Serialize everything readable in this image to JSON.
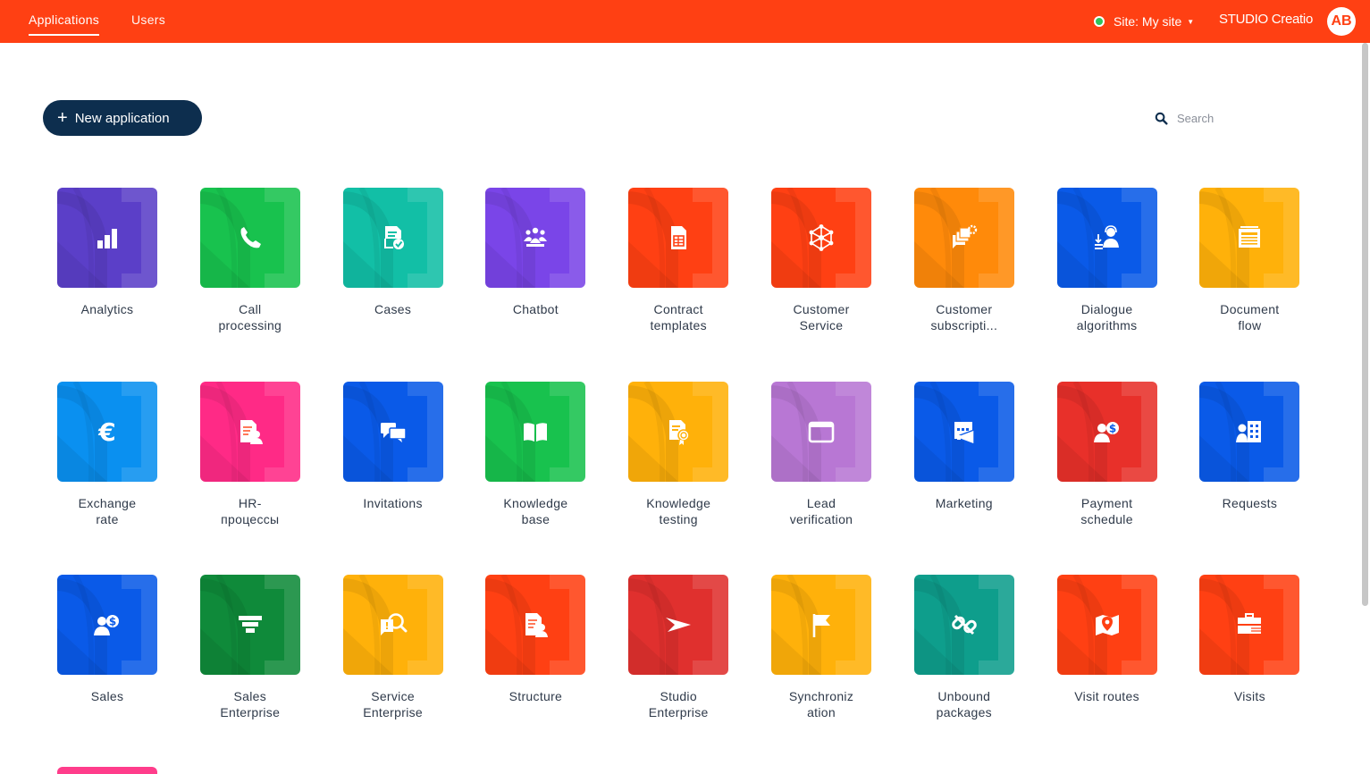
{
  "topbar": {
    "tabs": [
      {
        "label": "Applications",
        "active": true
      },
      {
        "label": "Users",
        "active": false
      }
    ],
    "site_label": "Site: My site",
    "brand": "STUDIO Creatio",
    "avatar_initials": "AB",
    "status_color": "#2fc35b",
    "accent_color": "#ff4013"
  },
  "toolbar": {
    "new_app_label": "New application",
    "search_placeholder": "Search"
  },
  "apps": [
    {
      "label": "Analytics",
      "color": "#5b3fc8",
      "icon": "bar-chart-icon"
    },
    {
      "label": "Call\nprocessing",
      "color": "#18c24e",
      "icon": "phone-icon"
    },
    {
      "label": "Cases",
      "color": "#12bfa6",
      "icon": "document-check-icon"
    },
    {
      "label": "Chatbot",
      "color": "#7a45e8",
      "icon": "people-group-icon"
    },
    {
      "label": "Contract\ntemplates",
      "color": "#ff4013",
      "icon": "spreadsheet-icon"
    },
    {
      "label": "Customer\nService",
      "color": "#ff4013",
      "icon": "network-icon"
    },
    {
      "label": "Customer\nsubscripti...",
      "color": "#ff8a0a",
      "icon": "chat-gear-icon"
    },
    {
      "label": "Dialogue\nalgorithms",
      "color": "#0a5ae8",
      "icon": "support-agent-icon"
    },
    {
      "label": "Document\nflow",
      "color": "#ffb10a",
      "icon": "document-stack-icon"
    },
    {
      "label": "Exchange\nrate",
      "color": "#0a90f0",
      "icon": "euro-icon"
    },
    {
      "label": "HR-\nпроцессы",
      "color": "#ff2a86",
      "icon": "document-person-icon"
    },
    {
      "label": "Invitations",
      "color": "#0a5ae8",
      "icon": "chat-bubbles-icon"
    },
    {
      "label": "Knowledge\nbase",
      "color": "#18c24e",
      "icon": "open-book-icon"
    },
    {
      "label": "Knowledge\ntesting",
      "color": "#ffb10a",
      "icon": "certificate-icon"
    },
    {
      "label": "Lead\nverification",
      "color": "#b877d4",
      "icon": "browser-window-icon"
    },
    {
      "label": "Marketing",
      "color": "#0a5ae8",
      "icon": "calendar-megaphone-icon"
    },
    {
      "label": "Payment\nschedule",
      "color": "#e8302a",
      "icon": "person-dollar-icon"
    },
    {
      "label": "Requests",
      "color": "#0a5ae8",
      "icon": "building-person-icon"
    },
    {
      "label": "Sales",
      "color": "#0a5ae8",
      "icon": "person-dollar-icon"
    },
    {
      "label": "Sales\nEnterprise",
      "color": "#0f8a3a",
      "icon": "funnel-icon"
    },
    {
      "label": "Service\nEnterprise",
      "color": "#ffb10a",
      "icon": "search-document-icon"
    },
    {
      "label": "Structure",
      "color": "#ff4013",
      "icon": "document-person-icon"
    },
    {
      "label": "Studio\nEnterprise",
      "color": "#e0302e",
      "icon": "paper-plane-icon"
    },
    {
      "label": "Synchroniz\nation",
      "color": "#ffb10a",
      "icon": "flag-icon"
    },
    {
      "label": "Unbound\npackages",
      "color": "#0e9e8c",
      "icon": "broken-link-icon"
    },
    {
      "label": "Visit routes",
      "color": "#ff4013",
      "icon": "map-pin-icon"
    },
    {
      "label": "Visits",
      "color": "#ff4013",
      "icon": "briefcase-icon"
    }
  ]
}
